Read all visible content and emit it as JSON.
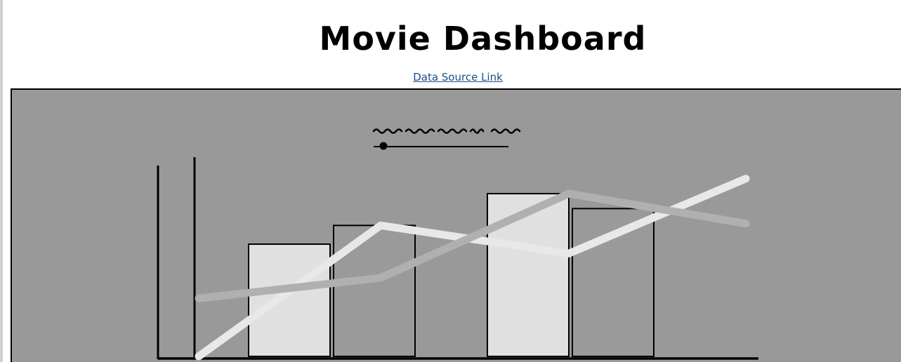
{
  "page": {
    "title": "Movie Dashboard",
    "source_link_label": "Data Source Link"
  },
  "colors": {
    "panel_background": "#999999",
    "bar_light": "#e0e0e0",
    "bar_dark": "#9a9a9a",
    "line_light": "#e8e8e8",
    "line_mid": "#b0b0b0",
    "axis": "#000000",
    "link": "#1a4f8a"
  },
  "icons": {
    "slider_control": "slider-icon"
  },
  "chart_data": {
    "type": "bar",
    "title": "",
    "xlabel": "",
    "ylabel": "",
    "ylim": [
      0,
      100
    ],
    "categories": [
      "",
      ""
    ],
    "series": [
      {
        "type": "bar",
        "values": [
          60,
          87
        ]
      },
      {
        "type": "bar",
        "values": [
          70,
          79
        ]
      }
    ],
    "lines": [
      {
        "type": "line",
        "values": [
          0,
          70,
          55,
          95
        ]
      },
      {
        "type": "line",
        "values": [
          31,
          42,
          87,
          71
        ]
      }
    ],
    "legend": "none",
    "grid": false
  }
}
